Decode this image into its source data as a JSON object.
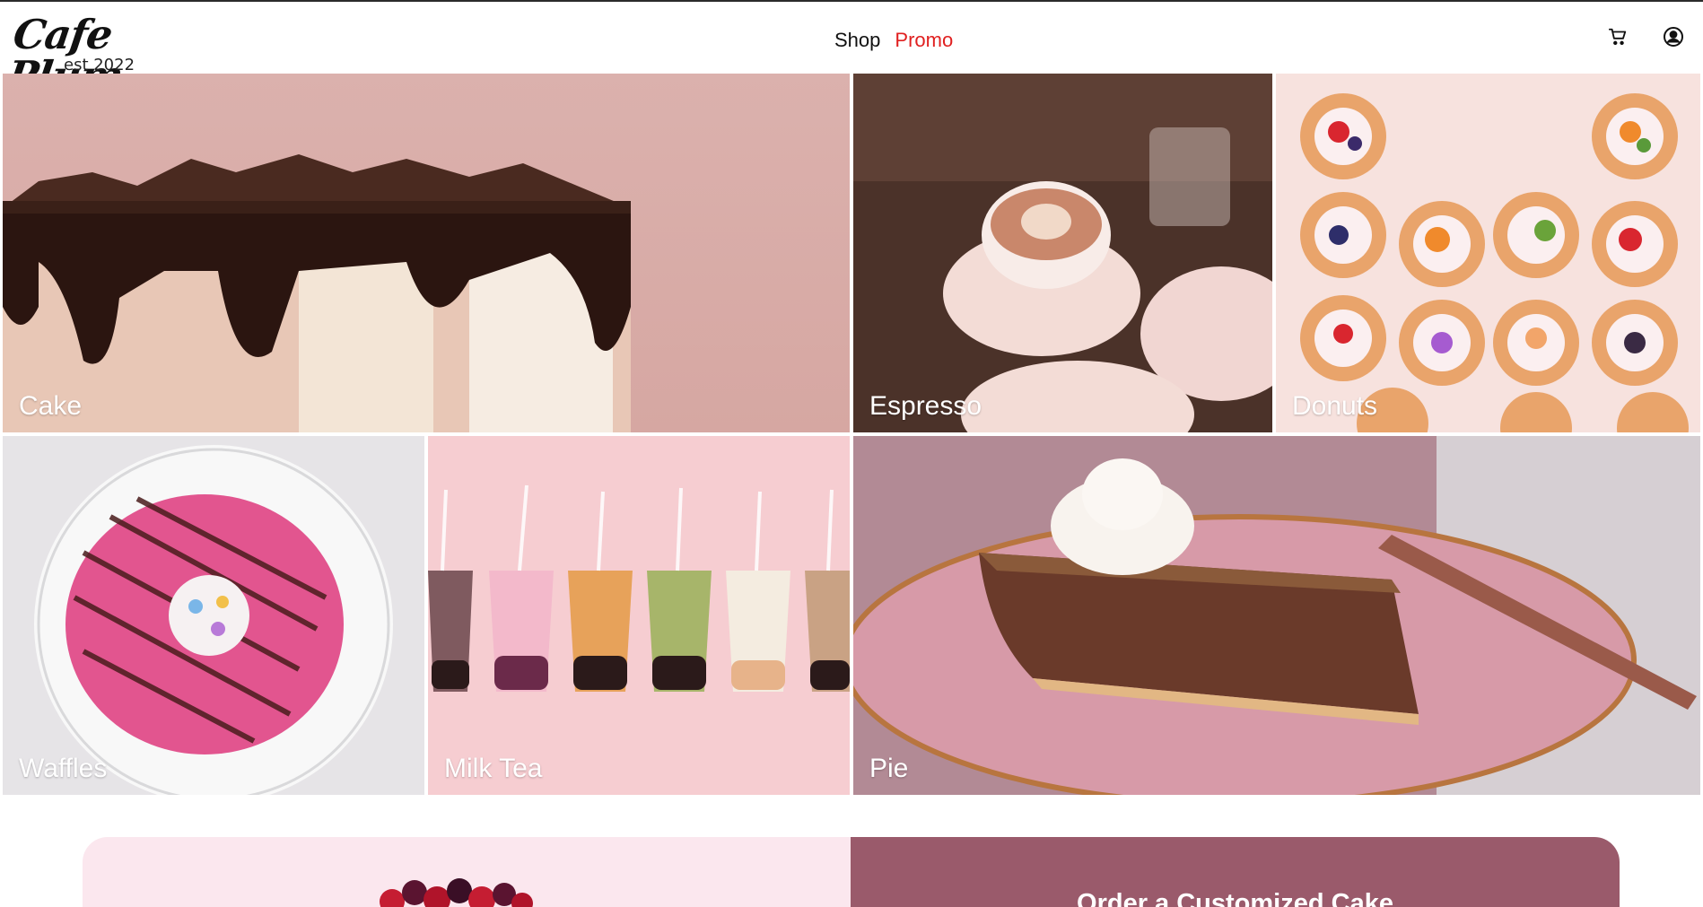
{
  "brand": {
    "name": "Cafe Plum",
    "tagline": "est 2022"
  },
  "nav": {
    "shop": "Shop",
    "promo": "Promo"
  },
  "icons": {
    "cart": "cart-icon",
    "account": "user-circle-icon"
  },
  "colors": {
    "promo_link": "#e02020",
    "promo_panel": "#9a5a6b",
    "promo_soft": "#fbe7ee"
  },
  "categories": [
    {
      "label": "Cake"
    },
    {
      "label": "Espresso"
    },
    {
      "label": "Donuts"
    },
    {
      "label": "Waffles"
    },
    {
      "label": "Milk Tea"
    },
    {
      "label": "Pie"
    }
  ],
  "promo": {
    "title": "Order a Customized Cake"
  }
}
